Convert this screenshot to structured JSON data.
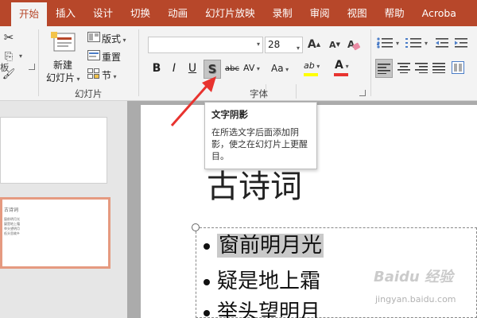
{
  "tabs": [
    "开始",
    "插入",
    "设计",
    "切换",
    "动画",
    "幻灯片放映",
    "录制",
    "审阅",
    "视图",
    "帮助",
    "Acroba"
  ],
  "ribbon": {
    "clipboard_group_label": "板",
    "slides": {
      "new_slide_line1": "新建",
      "new_slide_line2": "幻灯片",
      "layout_label": "版式",
      "reset_label": "重置",
      "section_label": "节",
      "group_label": "幻灯片"
    },
    "font": {
      "font_name_value": "",
      "font_size_value": "28",
      "bold_label": "B",
      "italic_label": "I",
      "underline_label": "U",
      "shadow_label": "S",
      "strike_label": "abc",
      "spacing_label": "AV",
      "case_label": "Aa",
      "highlight_label": "ab",
      "color_label": "A",
      "grow_label": "A",
      "shrink_label": "A",
      "group_label": "字体"
    }
  },
  "tooltip": {
    "title": "文字阴影",
    "body": "在所选文字后面添加阴影，使之在幻灯片上更醒目。"
  },
  "slide": {
    "title": "古诗词",
    "bullets": [
      "窗前明月光",
      "疑是地上霜",
      "举头望明月"
    ]
  },
  "thumbnail": {
    "title": "古诗词",
    "lines": [
      "窗前明月光",
      "疑是地上霜",
      "举头望明月",
      "低头思故乡"
    ]
  },
  "watermark": {
    "main": "Baidu 经验",
    "sub": "jingyan.baidu.com"
  },
  "colors": {
    "accent": "#b7472a",
    "arrow": "#e8332f",
    "highlight_yellow": "#ffff00",
    "font_red": "#e8332f"
  }
}
